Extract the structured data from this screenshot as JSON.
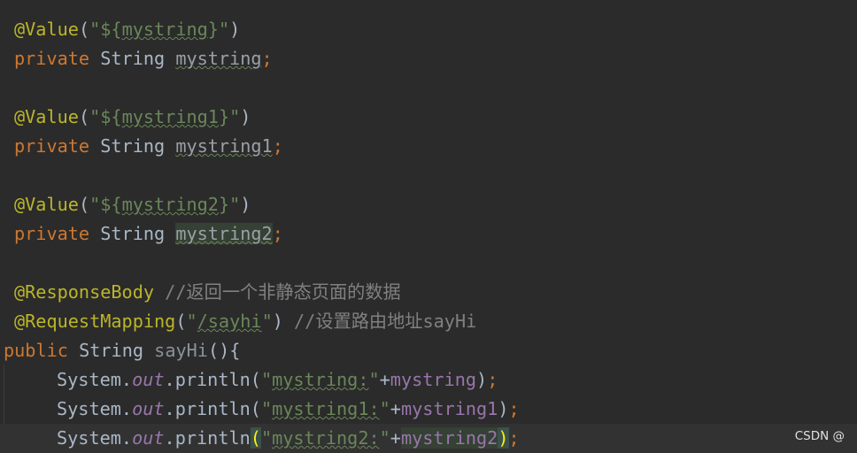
{
  "code": {
    "l1": {
      "ann": "@Value",
      "p1": "(",
      "str": "\"${",
      "ph": "mystring",
      "str2": "}\"",
      "p2": ")"
    },
    "l2": {
      "kw": "private",
      "type": " String ",
      "name": "mystring",
      "semi": ";"
    },
    "l4": {
      "ann": "@Value",
      "p1": "(",
      "str": "\"${",
      "ph": "mystring1",
      "str2": "}\"",
      "p2": ")"
    },
    "l5": {
      "kw": "private",
      "type": " String ",
      "name": "mystring1",
      "semi": ";"
    },
    "l7": {
      "ann": "@Value",
      "p1": "(",
      "str": "\"${",
      "ph": "mystring2",
      "str2": "}\"",
      "p2": ")"
    },
    "l8": {
      "kw": "private",
      "type": " String ",
      "name": "mystring2",
      "semi": ";"
    },
    "l10": {
      "ann": "@ResponseBody",
      "cmt_slash": " //",
      "cmt_text": "返回一个非静态页面的数据"
    },
    "l11": {
      "ann": "@RequestMapping",
      "p1": "(",
      "q1": "\"",
      "path": "/sayhi",
      "q2": "\"",
      "p2": ")",
      "cmt_slash": " //",
      "cmt_text": "设置路由地址",
      "cmt_tail": "sayHi"
    },
    "l12": {
      "kw": "public",
      "type": " String ",
      "method": "sayHi",
      "rest": "(){"
    },
    "l13": {
      "obj": "System.",
      "out": "out",
      "call": ".println(",
      "s1": "\"",
      "s2": "mystring:",
      "s3": "\"",
      "plus": "+",
      "fld": "mystring",
      "close": ")",
      "semi": ";"
    },
    "l14": {
      "obj": "System.",
      "out": "out",
      "call": ".println(",
      "s1": "\"",
      "s2": "mystring1:",
      "s3": "\"",
      "plus": "+",
      "fld": "mystring1",
      "close": ")",
      "semi": ";"
    },
    "l15": {
      "obj": "System.",
      "out": "out",
      "call": ".println",
      "open": "(",
      "s1": "\"",
      "s2": "mystring2:",
      "s3": "\"",
      "plus": "+",
      "fld": "mystring2",
      "close": ")",
      "semi": ";"
    }
  },
  "watermark": "CSDN @",
  "colors": {
    "background": "#2b2b2b",
    "annotation": "#bbb529",
    "keyword": "#cc7832",
    "string": "#6a8759",
    "field": "#9876aa",
    "comment": "#808080",
    "default": "#a9b7c6"
  }
}
